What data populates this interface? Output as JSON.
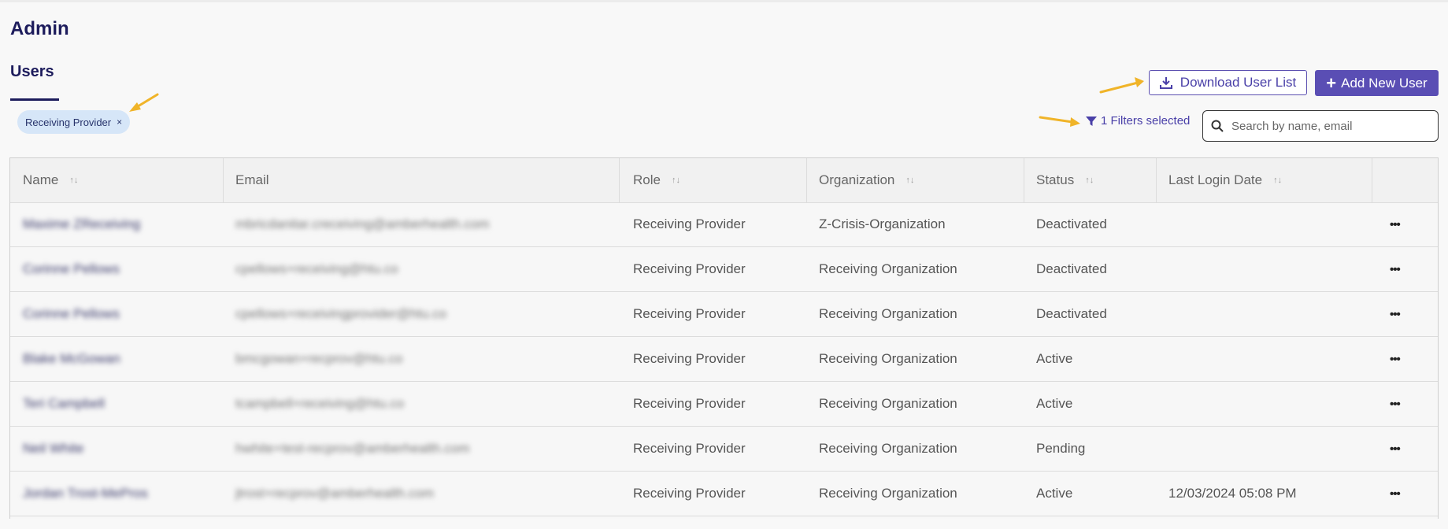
{
  "page": {
    "title": "Admin"
  },
  "tabs": [
    {
      "label": "Users",
      "active": true
    }
  ],
  "filter_chips": [
    {
      "label": "Receiving Provider",
      "close_label": "×"
    }
  ],
  "actions": {
    "download_label": "Download User List",
    "add_label": "Add New User",
    "add_prefix": "+",
    "filters_label": "1 Filters selected"
  },
  "search": {
    "placeholder": "Search by name, email",
    "value": ""
  },
  "table": {
    "columns": [
      {
        "label": "Name",
        "sortable": true
      },
      {
        "label": "Email",
        "sortable": false
      },
      {
        "label": "Role",
        "sortable": true
      },
      {
        "label": "Organization",
        "sortable": true
      },
      {
        "label": "Status",
        "sortable": true
      },
      {
        "label": "Last Login Date",
        "sortable": true
      },
      {
        "label": "",
        "sortable": false
      }
    ],
    "sort_glyph": "↑↓",
    "more_glyph": "•••",
    "rows": [
      {
        "name": "Maxime ZReceiving",
        "email": "mbricdanitar.creceiving@amberhealth.com",
        "role": "Receiving Provider",
        "organization": "Z-Crisis-Organization",
        "status": "Deactivated",
        "last_login": ""
      },
      {
        "name": "Corinne Pellows",
        "email": "cpellows+receiving@htu.co",
        "role": "Receiving Provider",
        "organization": "Receiving Organization",
        "status": "Deactivated",
        "last_login": ""
      },
      {
        "name": "Corinne Pellows",
        "email": "cpellows+receivingprovider@htu.co",
        "role": "Receiving Provider",
        "organization": "Receiving Organization",
        "status": "Deactivated",
        "last_login": ""
      },
      {
        "name": "Blake McGowan",
        "email": "bmcgowan+recprov@htu.co",
        "role": "Receiving Provider",
        "organization": "Receiving Organization",
        "status": "Active",
        "last_login": ""
      },
      {
        "name": "Teri Campbell",
        "email": "tcampbell+receiving@htu.co",
        "role": "Receiving Provider",
        "organization": "Receiving Organization",
        "status": "Active",
        "last_login": ""
      },
      {
        "name": "Neil White",
        "email": "hwhite+test-recprov@amberhealth.com",
        "role": "Receiving Provider",
        "organization": "Receiving Organization",
        "status": "Pending",
        "last_login": ""
      },
      {
        "name": "Jordan Trost-MePros",
        "email": "jtrost+recprov@amberhealth.com",
        "role": "Receiving Provider",
        "organization": "Receiving Organization",
        "status": "Active",
        "last_login": "12/03/2024 05:08 PM"
      }
    ]
  },
  "colors": {
    "brand": "#5a4eb4",
    "title": "#1d1c5c",
    "chip_bg": "#d6e6f8",
    "annotation_arrow": "#f0b429"
  },
  "icons": [
    "download-icon",
    "plus-icon",
    "filter-icon",
    "search-icon",
    "sort-icon",
    "more-icon",
    "close-icon",
    "annotation-arrow"
  ]
}
